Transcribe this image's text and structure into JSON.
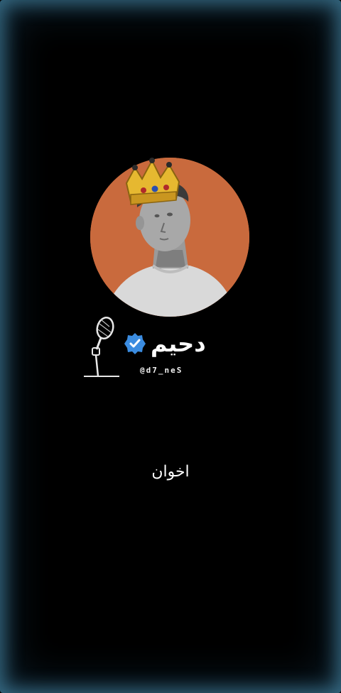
{
  "profile": {
    "display_name": "دحيم",
    "handle": "@d7_neS",
    "verified": true,
    "avatar_background": "#c96a3d",
    "verified_color": "#3b8ce0"
  },
  "caption": "اخوان",
  "icons": {
    "crown": "crown-icon",
    "microphone": "microphone-icon",
    "verified": "verified-badge-icon"
  },
  "colors": {
    "background": "#000000",
    "edge_glow": "#5aaacd"
  }
}
